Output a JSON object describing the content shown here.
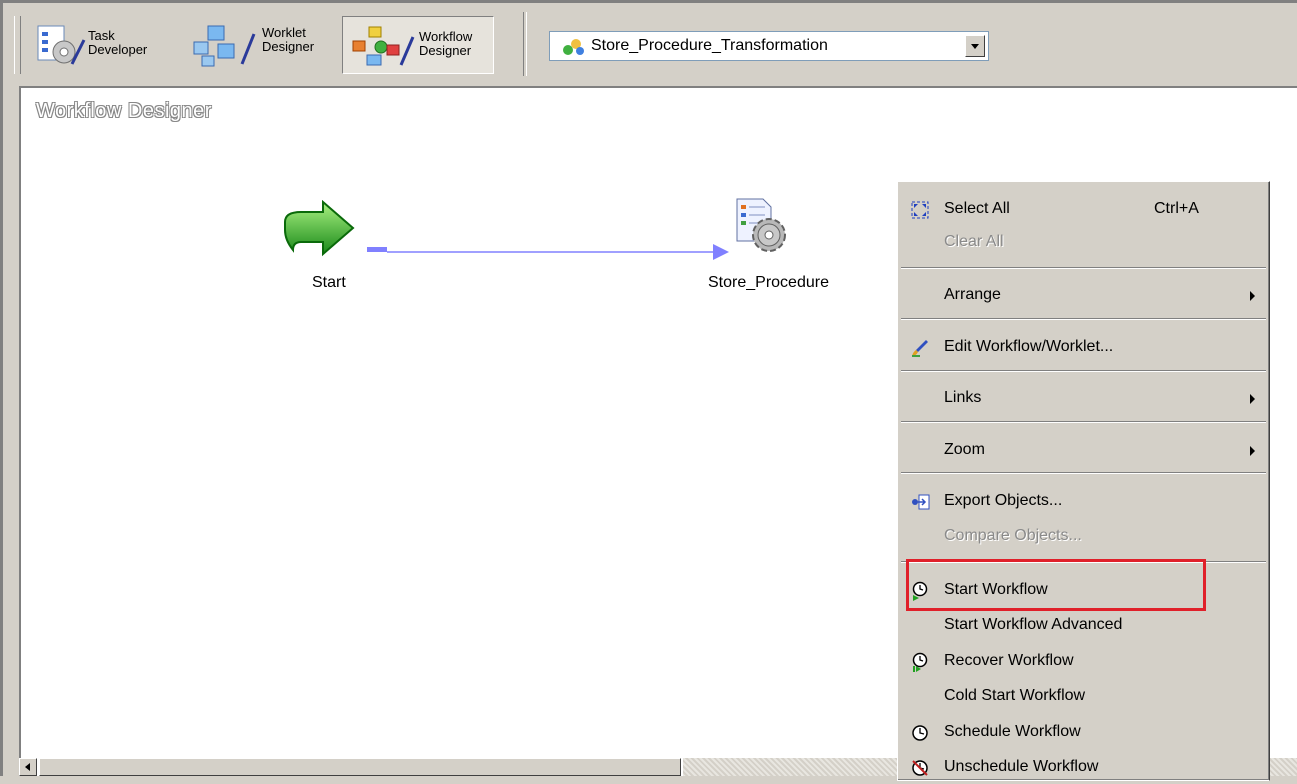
{
  "toolbar": {
    "task_developer": "Task\nDeveloper",
    "worklet_designer": "Worklet\nDesigner",
    "workflow_designer": "Workflow\nDesigner",
    "workflow_select": "Store_Procedure_Transformation"
  },
  "canvas": {
    "title": "Workflow Designer",
    "nodes": [
      {
        "label": "Start",
        "icon": "green-arrow-icon"
      },
      {
        "label": "Store_Procedure",
        "icon": "stored-procedure-gear-icon"
      }
    ]
  },
  "context_menu": {
    "items": [
      {
        "label": "Select All",
        "shortcut": "Ctrl+A",
        "icon": "select-all-icon"
      },
      {
        "label": "Clear All",
        "disabled": true
      },
      {
        "label": "Arrange",
        "submenu": true
      },
      {
        "label": "Edit Workflow/Worklet...",
        "icon": "edit-brush-icon"
      },
      {
        "label": "Links",
        "submenu": true
      },
      {
        "label": "Zoom",
        "submenu": true
      },
      {
        "label": "Export Objects...",
        "icon": "export-icon"
      },
      {
        "label": "Compare Objects...",
        "disabled": true
      },
      {
        "label": "Start Workflow",
        "icon": "clock-start-icon",
        "highlighted": true
      },
      {
        "label": "Start Workflow Advanced"
      },
      {
        "label": "Recover Workflow",
        "icon": "clock-recover-icon"
      },
      {
        "label": "Cold Start Workflow"
      },
      {
        "label": "Schedule Workflow",
        "icon": "clock-schedule-icon"
      },
      {
        "label": "Unschedule Workflow",
        "icon": "clock-unschedule-icon"
      }
    ]
  },
  "colors": {
    "highlight_box": "#e0202a",
    "link_line": "#8080ff"
  }
}
